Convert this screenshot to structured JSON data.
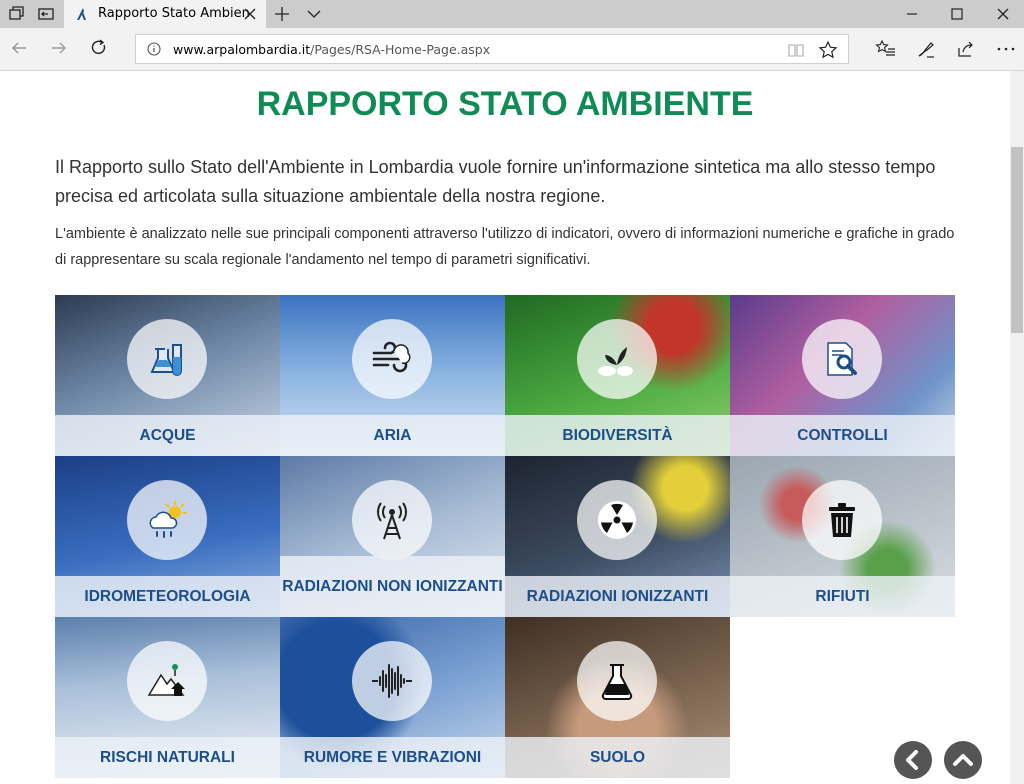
{
  "browser": {
    "tab_title": "Rapporto Stato Ambien",
    "url_domain": "www.arpalombardia.it",
    "url_path": "/Pages/RSA-Home-Page.aspx"
  },
  "page": {
    "title": "RAPPORTO STATO AMBIENTE",
    "intro": "Il Rapporto sullo Stato dell'Ambiente in Lombardia vuole fornire un'informazione sintetica ma allo stesso tempo precisa ed articolata sulla situazione ambientale della nostra regione.",
    "description": "L'ambiente è analizzato nelle sue principali componenti attraverso l'utilizzo di indicatori, ovvero di informazioni numeriche e grafiche in grado di rappresentare su scala regionale l'andamento nel tempo di parametri significativi."
  },
  "tiles": [
    {
      "label": "ACQUE",
      "icon": "flask-icon",
      "color": "#5a6f86"
    },
    {
      "label": "ARIA",
      "icon": "wind-icon",
      "color": "#5e8fc6"
    },
    {
      "label": "BIODIVERSITÀ",
      "icon": "sprout-icon",
      "color": "#3f9a3a"
    },
    {
      "label": "CONTROLLI",
      "icon": "document-search-icon",
      "color": "#6b5b8c"
    },
    {
      "label": "IDROMETEOROLOGIA",
      "icon": "weather-icon",
      "color": "#2f5aa8"
    },
    {
      "label": "RADIAZIONI NON IONIZZANTI",
      "icon": "antenna-icon",
      "color": "#7a8fae"
    },
    {
      "label": "RADIAZIONI IONIZZANTI",
      "icon": "radiation-icon",
      "color": "#36414f"
    },
    {
      "label": "RIFIUTI",
      "icon": "trash-icon",
      "color": "#8f9a9a"
    },
    {
      "label": "RISCHI NATURALI",
      "icon": "mountain-icon",
      "color": "#7f9ab8"
    },
    {
      "label": "RUMORE E VIBRAZIONI",
      "icon": "sound-wave-icon",
      "color": "#3b69a8"
    },
    {
      "label": "SUOLO",
      "icon": "soil-flask-icon",
      "color": "#6e5a48"
    }
  ],
  "colors": {
    "title": "#0f8c55",
    "tile_label": "#1c4f8a"
  }
}
